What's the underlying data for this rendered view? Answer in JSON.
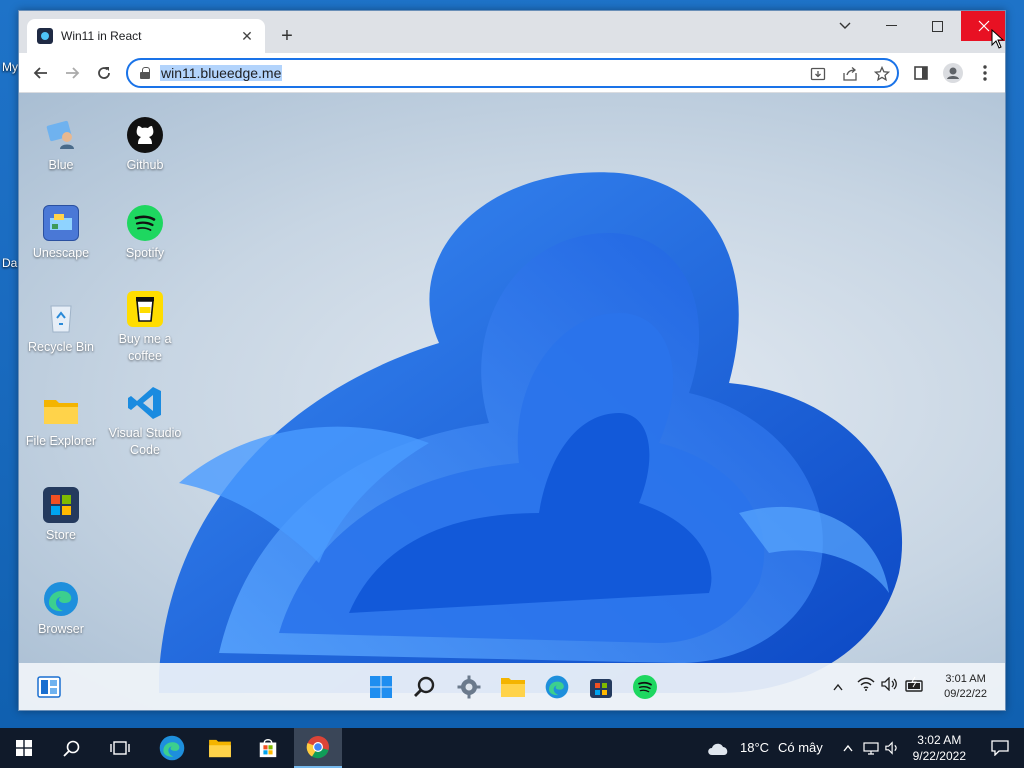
{
  "host": {
    "desktop_labels": [
      "My",
      "Da"
    ],
    "taskbar": {
      "weather_temp": "18°C",
      "weather_text": "Có mây",
      "time": "3:02 AM",
      "date": "9/22/2022"
    }
  },
  "browser": {
    "tab_title": "Win11 in React",
    "url": "win11.blueedge.me"
  },
  "win11": {
    "desktop_icons": [
      {
        "label": "Blue"
      },
      {
        "label": "Github"
      },
      {
        "label": "Unescape"
      },
      {
        "label": "Spotify"
      },
      {
        "label": "Recycle Bin"
      },
      {
        "label": "Buy me a coffee"
      },
      {
        "label": "File Explorer"
      },
      {
        "label": "Visual Studio Code"
      },
      {
        "label": "Store"
      },
      {
        "label": "Browser"
      }
    ],
    "taskbar": {
      "time": "3:01 AM",
      "date": "09/22/22"
    }
  },
  "colors": {
    "accent": "#1a73e8",
    "close": "#e81123",
    "bloom": "#1565e0"
  }
}
